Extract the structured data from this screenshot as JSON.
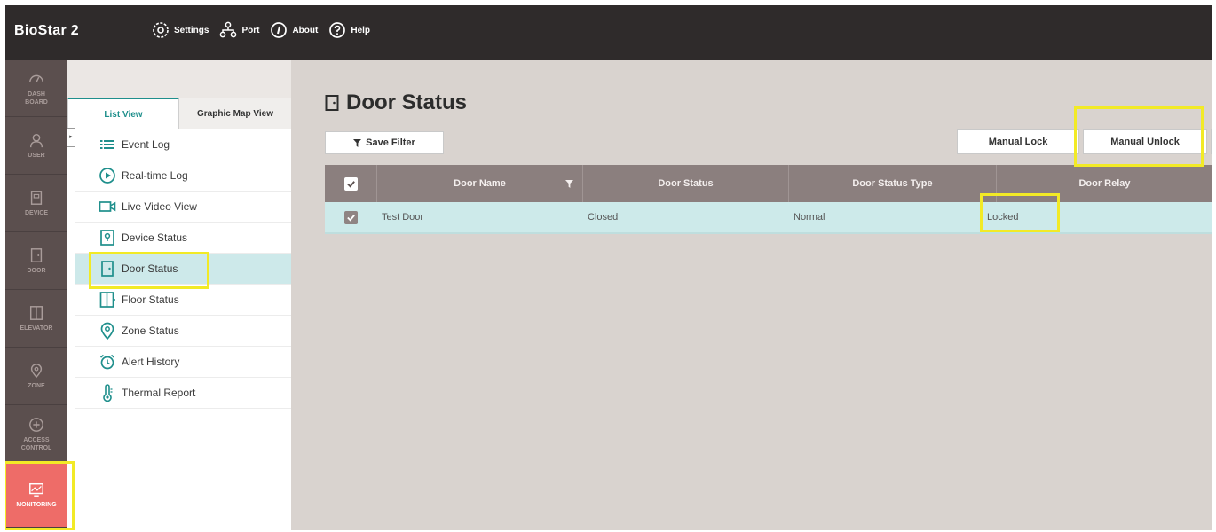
{
  "app": {
    "title": "BioStar 2"
  },
  "topnav": [
    {
      "label": "Settings",
      "icon": "gear-icon"
    },
    {
      "label": "Port",
      "icon": "network-icon"
    },
    {
      "label": "About",
      "icon": "info-icon"
    },
    {
      "label": "Help",
      "icon": "help-icon"
    }
  ],
  "rail": [
    {
      "label_1": "DASH",
      "label_2": "BOARD",
      "icon": "dashboard-icon"
    },
    {
      "label_1": "USER",
      "label_2": "",
      "icon": "user-icon"
    },
    {
      "label_1": "DEVICE",
      "label_2": "",
      "icon": "device-icon"
    },
    {
      "label_1": "DOOR",
      "label_2": "",
      "icon": "door-icon"
    },
    {
      "label_1": "ELEVATOR",
      "label_2": "",
      "icon": "elevator-icon"
    },
    {
      "label_1": "ZONE",
      "label_2": "",
      "icon": "zone-icon"
    },
    {
      "label_1": "ACCESS",
      "label_2": "CONTROL",
      "icon": "access-control-icon"
    },
    {
      "label_1": "MONITORING",
      "label_2": "",
      "icon": "monitoring-icon",
      "active": true
    }
  ],
  "tabs": {
    "list_view": "List View",
    "map_view": "Graphic Map View"
  },
  "menu": [
    {
      "label": "Event Log",
      "icon": "event-log-icon"
    },
    {
      "label": "Real-time Log",
      "icon": "play-icon"
    },
    {
      "label": "Live Video View",
      "icon": "video-camera-icon"
    },
    {
      "label": "Device Status",
      "icon": "device-status-icon"
    },
    {
      "label": "Door Status",
      "icon": "door-status-icon",
      "active": true
    },
    {
      "label": "Floor Status",
      "icon": "floor-status-icon"
    },
    {
      "label": "Zone Status",
      "icon": "location-pin-icon"
    },
    {
      "label": "Alert History",
      "icon": "alarm-clock-icon"
    },
    {
      "label": "Thermal Report",
      "icon": "thermometer-icon"
    }
  ],
  "main": {
    "title": "Door Status",
    "save_filter": "Save Filter",
    "manual_lock": "Manual Lock",
    "manual_unlock": "Manual Unlock"
  },
  "table": {
    "columns": [
      "Door Name",
      "Door Status",
      "Door Status Type",
      "Door Relay"
    ],
    "rows": [
      {
        "door_name": "Test Door",
        "door_status": "Closed",
        "door_status_type": "Normal",
        "door_relay": "Locked",
        "checked": true
      }
    ]
  },
  "colors": {
    "topbar": "#2f2b2b",
    "rail": "#5b4f4e",
    "rail_active": "#ee6c68",
    "accent": "#1f8f8c",
    "row_selected": "#cdeaea",
    "table_header": "#8b7f7e",
    "highlight": "#f2ea26"
  }
}
